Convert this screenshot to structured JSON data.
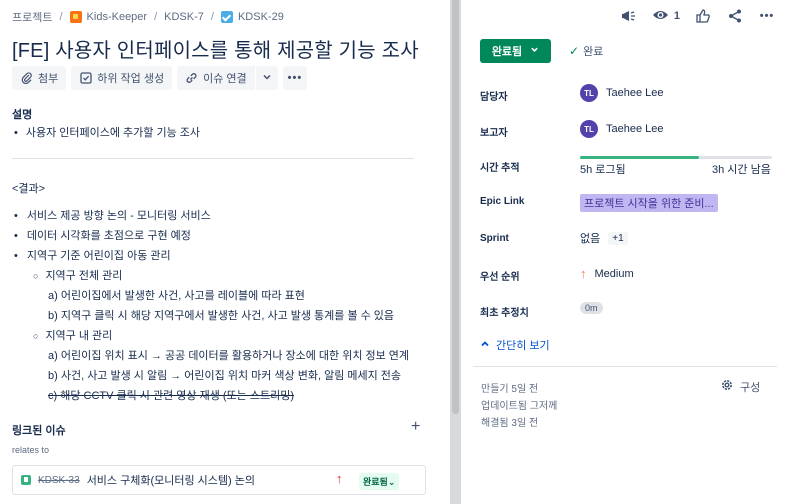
{
  "breadcrumbs": {
    "root": "프로젝트",
    "project": "Kids-Keeper",
    "parent": "KDSK-7",
    "issue": "KDSK-29"
  },
  "issue": {
    "title": "[FE] 사용자 인터페이스를 통해 제공할 기능 조사"
  },
  "toolbar": {
    "attach": "첨부",
    "subtask": "하위 작업 생성",
    "link": "이슈 연결"
  },
  "description": {
    "heading": "설명",
    "items": [
      "사용자 인터페이스에 추가할 기능 조사"
    ],
    "result_heading": "<결과>",
    "result_lines": [
      "서비스 제공 방향 논의 - 모니터링 서비스",
      "데이터 시각화를 초점으로 구현 예정",
      "지역구 기준 어린이집 아동 관리",
      "지역구 전체 관리",
      "a) 어린이집에서 발생한 사건, 사고를 레이블에 따라 표현",
      "b) 지역구 클릭 시 해당 지역구에서 발생한 사건, 사고 발생 통계를 볼 수 있음",
      "지역구 내 관리",
      "a) 어린이집 위치 표시 → 공공 데이터를 활용하거나 장소에 대한 위치 정보 연계",
      "b) 사건, 사고 발생 시 알림 → 어린이집 위치 마커 색상 변화, 알림 메세지 전송",
      "c) 해당 CCTV 클릭 시 관련 영상 재생 (또는 스트리밍)"
    ]
  },
  "linked": {
    "heading": "링크된 이슈",
    "relation": "relates to",
    "key": "KDSK-33",
    "summary": "서비스 구체화(모니터링 시스템) 논의",
    "status": "완료됨"
  },
  "header_actions": {
    "watch_count": "1"
  },
  "status": {
    "label": "완료됨",
    "resolution": "완료"
  },
  "fields": {
    "assignee_label": "담당자",
    "assignee": "Taehee Lee",
    "assignee_initials": "TL",
    "reporter_label": "보고자",
    "reporter": "Taehee Lee",
    "reporter_initials": "TL",
    "time_label": "시간 추적",
    "time_logged": "5h 로그됨",
    "time_remaining": "3h 시간 남음",
    "time_progress": 0.62,
    "epic_label": "Epic Link",
    "epic": "프로젝트 시작을 위한 준비...",
    "sprint_label": "Sprint",
    "sprint": "없음",
    "sprint_more": "+1",
    "priority_label": "우선 순위",
    "priority": "Medium",
    "estimate_label": "최초 추정치",
    "estimate": "0m"
  },
  "collapse_label": "간단히 보기",
  "meta": {
    "created": "만들기 5일 전",
    "updated": "업데이트됨 그저께",
    "resolved": "해결됨 3일 전",
    "configure": "구성"
  },
  "colors": {
    "status_done": "#00875a",
    "epic_bg": "#c0b6f2",
    "avatar": "#5243aa",
    "link_blue": "#0052cc"
  }
}
